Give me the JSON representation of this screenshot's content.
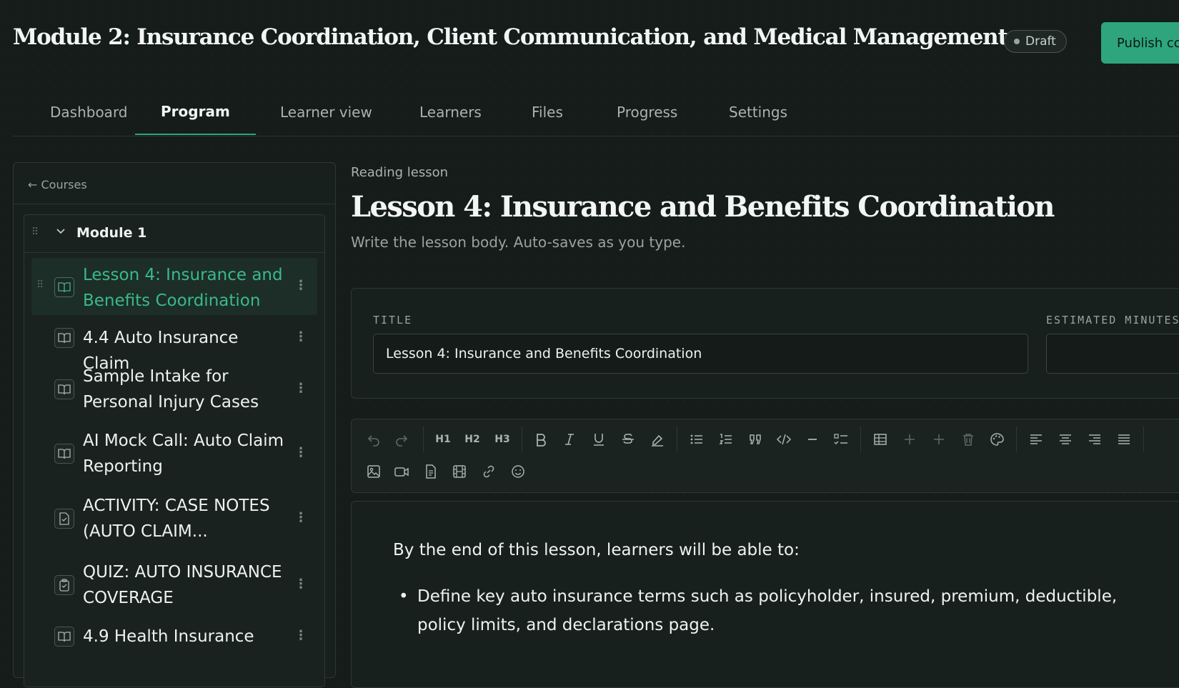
{
  "header": {
    "title": "Module 2: Insurance Coordination, Client Communication, and Medical Management",
    "status_badge": "Draft",
    "publish_label": "Publish co"
  },
  "tabs": [
    {
      "label": "Dashboard"
    },
    {
      "label": "Program",
      "active": true
    },
    {
      "label": "Learner view"
    },
    {
      "label": "Learners"
    },
    {
      "label": "Files"
    },
    {
      "label": "Progress"
    },
    {
      "label": "Settings"
    }
  ],
  "sidebar": {
    "back_label": "Courses",
    "module_title": "Module 1",
    "items": [
      {
        "label": "Lesson 4: Insurance and Benefits Coordination",
        "icon": "book-icon",
        "active": true
      },
      {
        "label": "4.4 Auto Insurance Claim",
        "icon": "book-icon"
      },
      {
        "label": "Sample Intake for Personal Injury Cases",
        "icon": "book-icon"
      },
      {
        "label": "AI Mock Call: Auto Claim Reporting",
        "icon": "book-icon"
      },
      {
        "label": "ACTIVITY: CASE NOTES (AUTO CLAIM...",
        "icon": "file-check-icon"
      },
      {
        "label": "QUIZ: AUTO INSURANCE COVERAGE",
        "icon": "clipboard-check-icon"
      },
      {
        "label": "4.9 Health Insurance",
        "icon": "book-icon"
      }
    ]
  },
  "main": {
    "kicker": "Reading lesson",
    "title": "Lesson 4: Insurance and Benefits Coordination",
    "subtitle": "Write the lesson body. Auto-saves as you type.",
    "form": {
      "title_label": "TITLE",
      "title_value": "Lesson 4: Insurance and Benefits Coordination",
      "minutes_label": "ESTIMATED MINUTES",
      "minutes_value": ""
    },
    "toolbar": {
      "h1": "H1",
      "h2": "H2",
      "h3": "H3",
      "icons": [
        "undo-icon",
        "redo-icon",
        "bold-icon",
        "italic-icon",
        "underline-icon",
        "strikethrough-icon",
        "highlight-icon",
        "bullet-list-icon",
        "ordered-list-icon",
        "quote-icon",
        "code-icon",
        "horizontal-rule-icon",
        "task-list-icon",
        "table-icon",
        "add-row-icon",
        "add-column-icon",
        "delete-table-icon",
        "color-palette-icon",
        "align-left-icon",
        "align-center-icon",
        "align-right-icon",
        "justify-icon",
        "image-icon",
        "video-icon",
        "document-icon",
        "film-icon",
        "link-icon",
        "emoji-icon"
      ]
    },
    "editor": {
      "intro": "By the end of this lesson, learners will be able to:",
      "bullets": [
        "Define key auto insurance terms such as policyholder, insured, premium, deductible, policy limits, and declarations page."
      ]
    }
  }
}
